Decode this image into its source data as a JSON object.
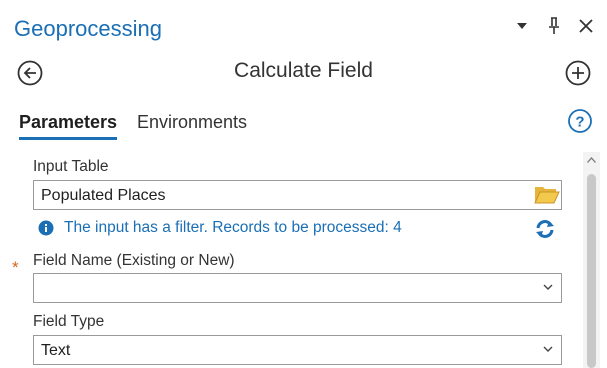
{
  "header": {
    "title": "Geoprocessing"
  },
  "tool": {
    "title": "Calculate Field"
  },
  "tabs": [
    {
      "label": "Parameters",
      "active": true
    },
    {
      "label": "Environments",
      "active": false
    }
  ],
  "form": {
    "input_table": {
      "label": "Input Table",
      "value": "Populated Places"
    },
    "filter_notice": "The input has a filter. Records to be processed: 4",
    "field_name": {
      "label": "Field Name (Existing or New)",
      "value": "",
      "required_marker": "*"
    },
    "field_type": {
      "label": "Field Type",
      "value": "Text"
    }
  },
  "icons": [
    "dropdown-caret-icon",
    "pin-icon",
    "close-icon",
    "back-arrow-icon",
    "add-icon",
    "help-icon",
    "folder-icon",
    "info-icon",
    "refresh-icon",
    "chevron-down-icon",
    "scroll-up-icon"
  ],
  "colors": {
    "accent": "#1b6fb5",
    "required": "#d4661f",
    "folder": "#e7b43b"
  }
}
